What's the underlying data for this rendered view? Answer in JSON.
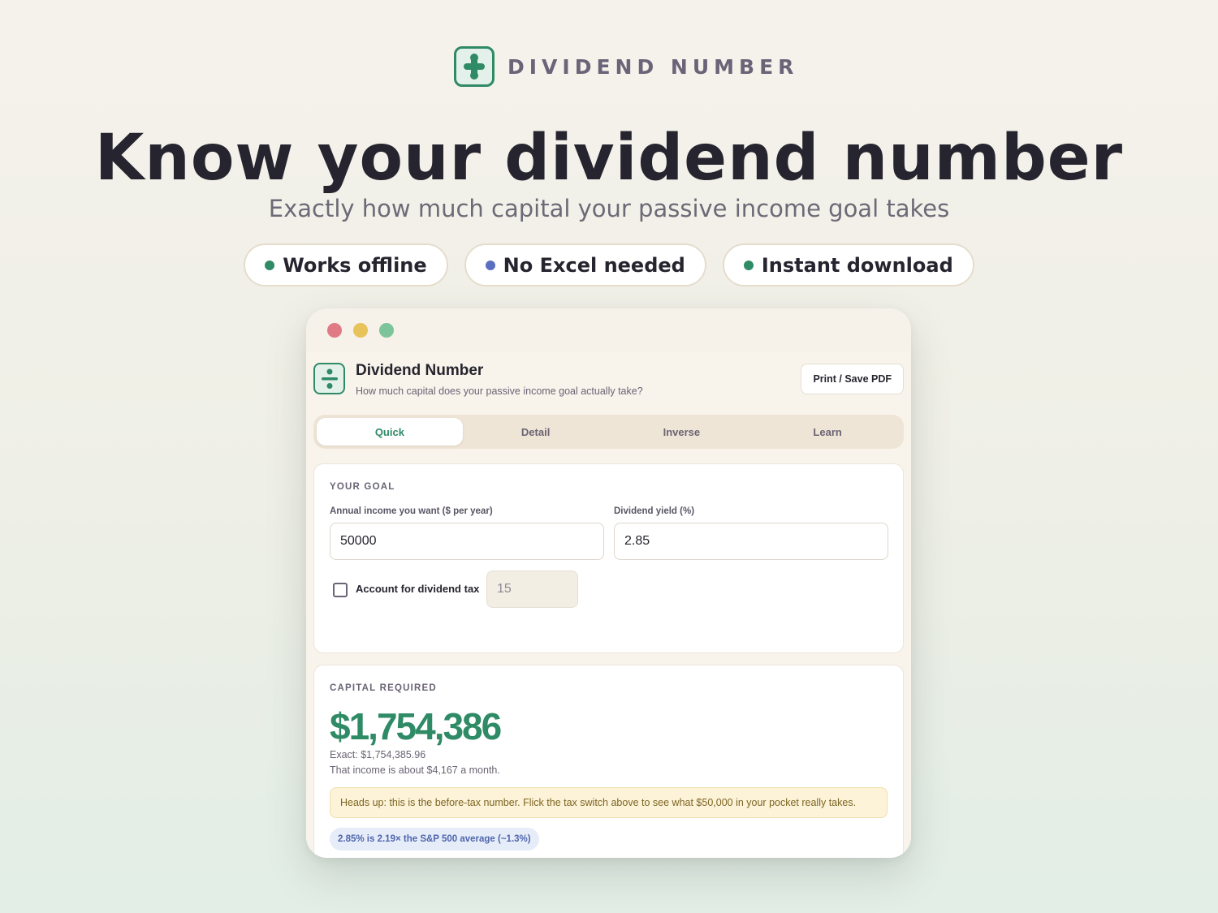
{
  "brand": {
    "name": "DIVIDEND NUMBER",
    "logo_icon": "divide-icon",
    "accent_color": "#2f8a66"
  },
  "hero": {
    "title": "Know your dividend number",
    "subtitle": "Exactly how much capital your passive income goal takes"
  },
  "pills": [
    {
      "label": "Works offline",
      "color": "#2f8a66"
    },
    {
      "label": "No Excel needed",
      "color": "#5a6fc0"
    },
    {
      "label": "Instant download",
      "color": "#2f8a66"
    }
  ],
  "window": {
    "traffic_lights": [
      "#e07a85",
      "#e8c25a",
      "#7ec49a"
    ]
  },
  "app": {
    "title": "Dividend Number",
    "subtitle": "How much capital does your passive income goal actually take?",
    "print_button": "Print / Save PDF"
  },
  "tabs": [
    {
      "label": "Quick",
      "active": true
    },
    {
      "label": "Detail",
      "active": false
    },
    {
      "label": "Inverse",
      "active": false
    },
    {
      "label": "Learn",
      "active": false
    }
  ],
  "goal": {
    "section_label": "YOUR GOAL",
    "income_label": "Annual income you want ($ per year)",
    "income_value": "50000",
    "yield_label": "Dividend yield (%)",
    "yield_value": "2.85",
    "tax_checkbox_label": "Account for dividend tax",
    "tax_checked": false,
    "tax_value": "15"
  },
  "capital": {
    "section_label": "CAPITAL REQUIRED",
    "amount": "$1,754,386",
    "exact": "Exact: $1,754,385.96",
    "monthly": "That income is about $4,167 a month.",
    "note": "Heads up: this is the before-tax number. Flick the tax switch above to see what $50,000 in your pocket really takes.",
    "comparison_badge": "2.85% is 2.19× the S&P 500 average (~1.3%)"
  }
}
